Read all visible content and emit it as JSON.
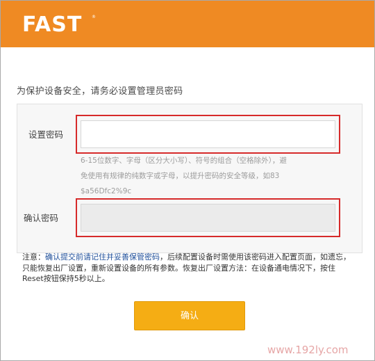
{
  "header": {
    "logo_text": "FAST",
    "brand_color": "#ef8a23"
  },
  "form": {
    "intro": "为保护设备安全，请务必设置管理员密码",
    "password_label": "设置密码",
    "password_value": "",
    "password_hint_line1": "6-15位数字、字母（区分大小写）、符号的组合（空格除外），避",
    "password_hint_line2": "免使用有规律的纯数字或字母，以提升密码的安全等级，如83",
    "password_hint_line3": "$a56Dfc2%9c",
    "confirm_label": "确认密码",
    "confirm_value": ""
  },
  "note": {
    "prefix": "注意：",
    "link": "确认提交前请记住并妥善保管密码",
    "text": "，后续配置设备时需使用该密码进入配置页面，如遗忘，只能恢复出厂设置，重新设置设备的所有参数。恢复出厂设置方法：在设备通电情况下，按住Reset按钮保持5秒以上。"
  },
  "confirm_button": {
    "label": "确认",
    "color": "#f5ad14"
  },
  "watermark": "www.192ly.com"
}
